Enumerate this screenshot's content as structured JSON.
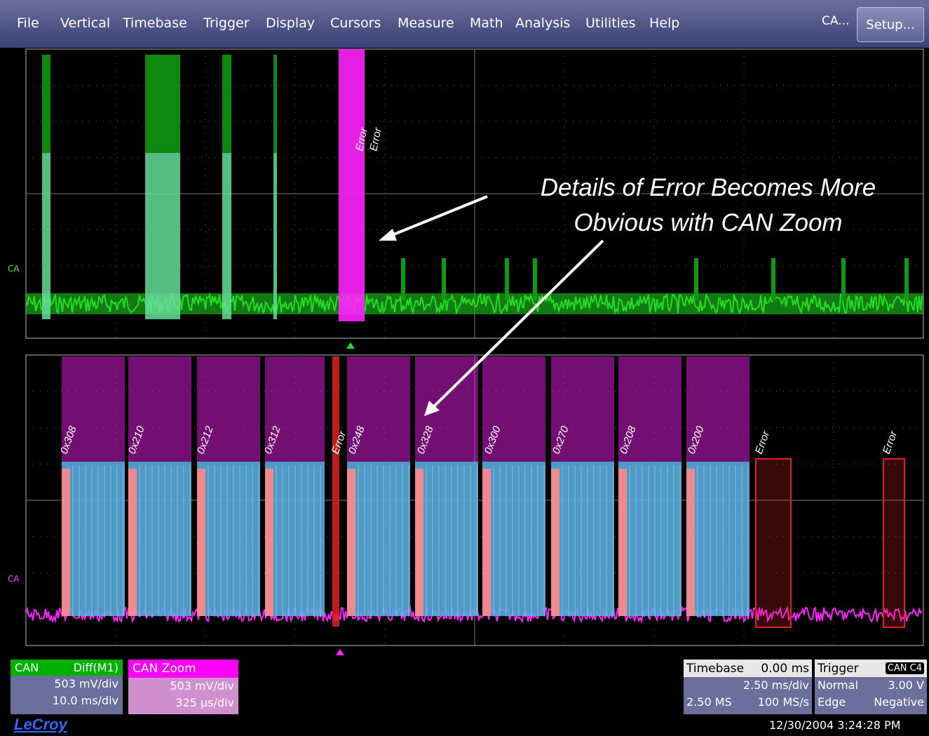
{
  "menubar": {
    "items": [
      "File",
      "Vertical",
      "Timebase",
      "Trigger",
      "Display",
      "Cursors",
      "Measure",
      "Math",
      "Analysis",
      "Utilities",
      "Help"
    ],
    "channel_shortcut": "CA...",
    "setup_label": "Setup..."
  },
  "colors": {
    "grid": "#7a7a7a",
    "can_trace": "#22dd22",
    "zoom_trace": "#ff22ff",
    "frame_fill": "#55aadd",
    "error_box": "#dd2222",
    "menubar": "#4a4f85"
  },
  "top_trace": {
    "channel_label": "CA",
    "decode_labels": [
      "Error",
      "Error"
    ]
  },
  "zoom_trace": {
    "channel_label": "CA",
    "decode_labels": [
      "0x308",
      "0x210",
      "0x212",
      "0x312",
      "Error",
      "0x248",
      "0x328",
      "0x300",
      "0x270",
      "0x208",
      "0x200",
      "Error",
      "Error"
    ]
  },
  "annotation": {
    "line1": "Details of Error Becomes More",
    "line2": "Obvious with CAN Zoom"
  },
  "can_descriptor": {
    "name": "CAN",
    "source": "Diff(M1)",
    "vdiv": "503 mV/div",
    "tdiv": "10.0 ms/div"
  },
  "zoom_descriptor": {
    "name": "CAN Zoom",
    "vdiv": "503 mV/div",
    "tdiv": "325 µs/div"
  },
  "timebase_descriptor": {
    "title": "Timebase",
    "delay": "0.00 ms",
    "tdiv": "2.50 ms/div",
    "samples": "2.50 MS",
    "rate": "100 MS/s"
  },
  "trigger_descriptor": {
    "title": "Trigger",
    "source": "CAN C4",
    "mode": "Normal",
    "level": "3.00 V",
    "type": "Edge",
    "slope": "Negative"
  },
  "logo": "LeCroy",
  "timestamp": "12/30/2004 3:24:28 PM"
}
